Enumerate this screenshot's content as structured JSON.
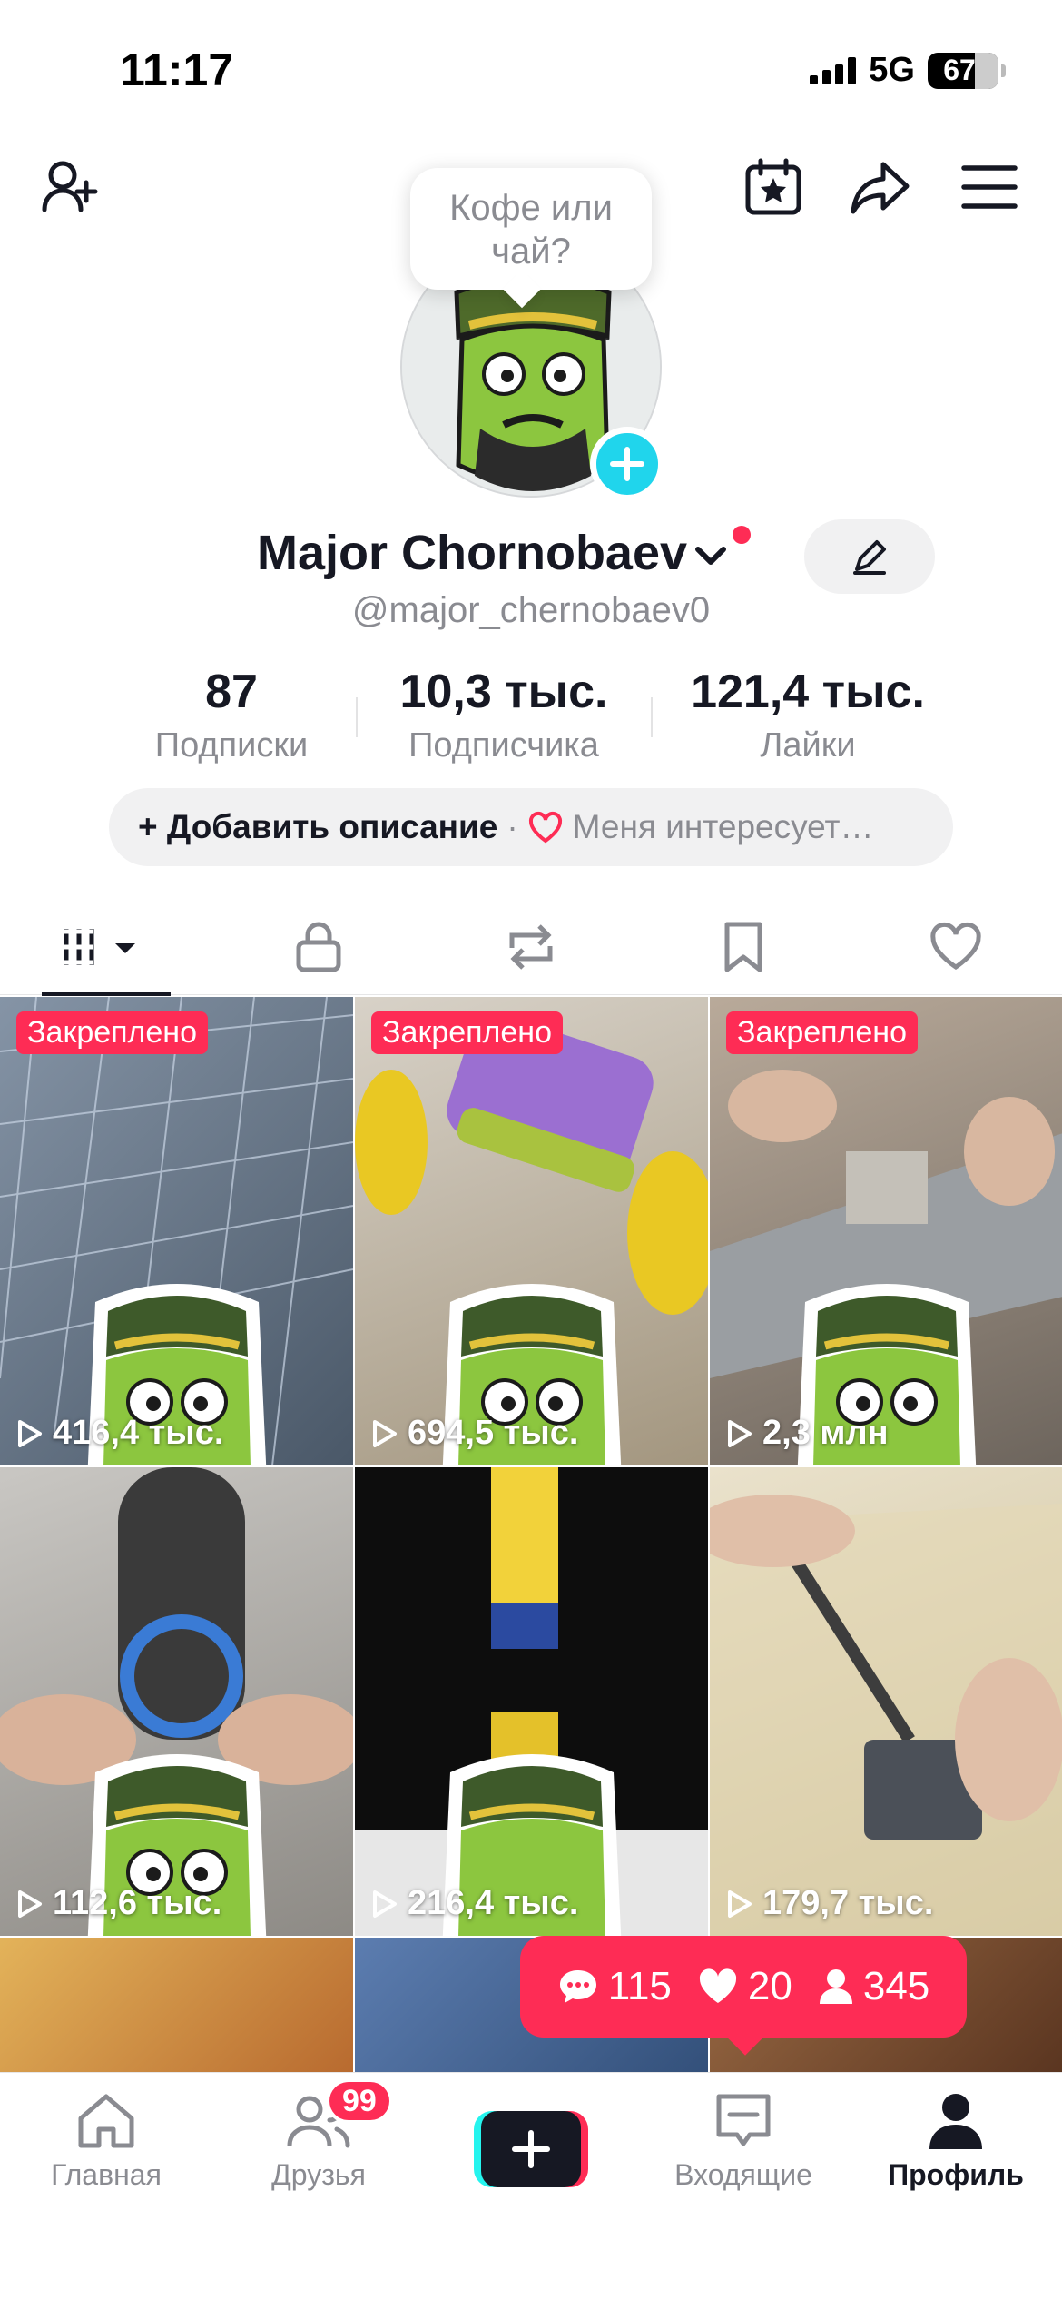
{
  "status_bar": {
    "time": "11:17",
    "network": "5G",
    "battery": "67",
    "battery_level": 0.67
  },
  "header": {
    "add_friend_icon": "person-add-icon",
    "calendar_icon": "calendar-star-icon",
    "share_icon": "share-arrow-icon",
    "menu_icon": "hamburger-menu-icon"
  },
  "profile": {
    "bubble_text": "Кофе или чай?",
    "display_name": "Major Chornobaev",
    "handle": "@major_chernobaev0",
    "stats": [
      {
        "value": "87",
        "label": "Подписки"
      },
      {
        "value": "10,3 тыс.",
        "label": "Подписчика"
      },
      {
        "value": "121,4 тыс.",
        "label": "Лайки"
      }
    ],
    "add_description": "+ Добавить описание",
    "separator": "·",
    "interests": "Меня интересует…"
  },
  "tabs": [
    {
      "name": "videos",
      "icon": "grid-icon",
      "active": true
    },
    {
      "name": "private",
      "icon": "lock-icon"
    },
    {
      "name": "reposts",
      "icon": "repost-icon"
    },
    {
      "name": "favorites",
      "icon": "bookmark-icon"
    },
    {
      "name": "liked",
      "icon": "heart-icon"
    }
  ],
  "videos": [
    {
      "pinned": "Закреплено",
      "views": "416,4 тыс.",
      "bg": "#6e7c8e"
    },
    {
      "pinned": "Закреплено",
      "views": "694,5 тыс.",
      "bg": "#b7a896"
    },
    {
      "pinned": "Закреплено",
      "views": "2,3 млн",
      "bg": "#8e8780"
    },
    {
      "pinned": "",
      "views": "112,6 тыс.",
      "bg": "#a9a7a4"
    },
    {
      "pinned": "",
      "views": "216,4 тыс.",
      "bg": "#111111"
    },
    {
      "pinned": "",
      "views": "179,7 тыс.",
      "bg": "#d9cfb4"
    },
    {
      "pinned": "",
      "views": "",
      "bg": "#c98a3a"
    },
    {
      "pinned": "",
      "views": "",
      "bg": "#4b6c9a"
    },
    {
      "pinned": "",
      "views": "",
      "bg": "#7a4a2c"
    }
  ],
  "notification": {
    "comments": "115",
    "likes": "20",
    "followers": "345"
  },
  "bottom_nav": [
    {
      "label": "Главная",
      "icon": "home-icon"
    },
    {
      "label": "Друзья",
      "icon": "friends-icon",
      "badge": "99"
    },
    {
      "label": "",
      "icon": "plus-icon"
    },
    {
      "label": "Входящие",
      "icon": "inbox-icon"
    },
    {
      "label": "Профиль",
      "icon": "profile-icon",
      "active": true
    }
  ],
  "colors": {
    "accent": "#fe2c55",
    "cyan": "#25f4ee",
    "text": "#161823",
    "muted": "#8a8b91"
  }
}
